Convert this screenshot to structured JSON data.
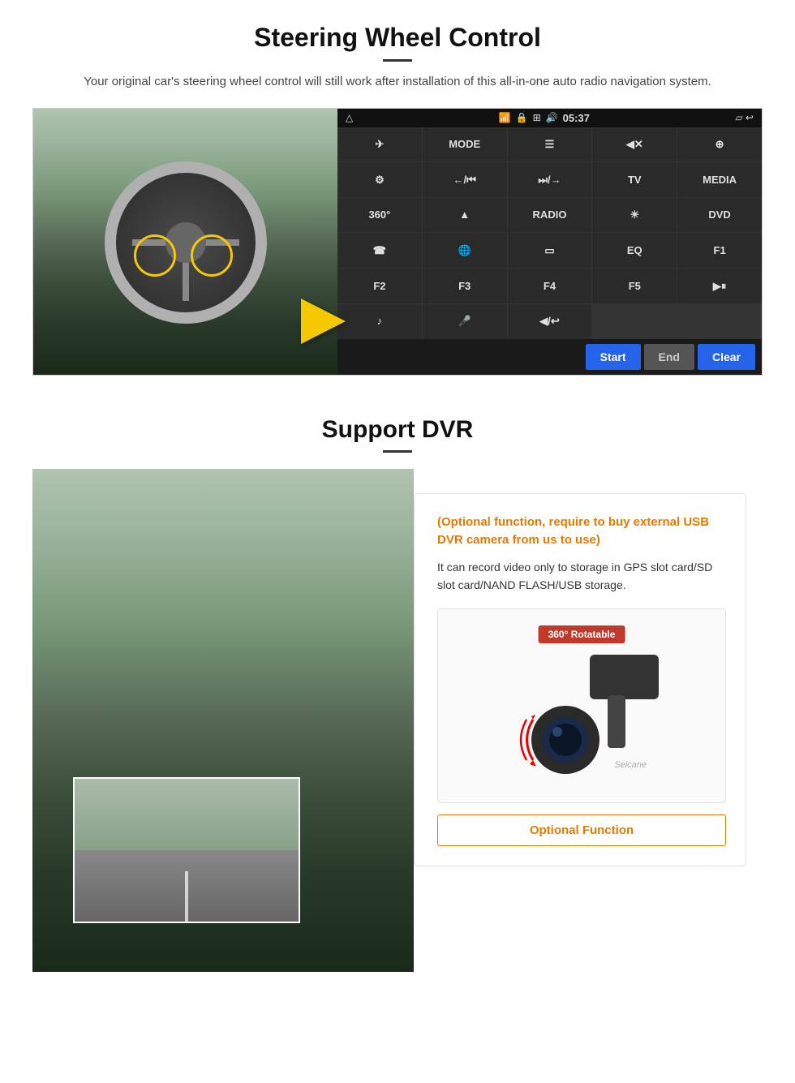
{
  "section1": {
    "title": "Steering Wheel Control",
    "subtitle": "Your original car's steering wheel control will still work after installation of this all-in-one auto radio navigation system.",
    "status_bar": {
      "time": "05:37",
      "icons": [
        "wifi",
        "lock",
        "grid",
        "volume"
      ]
    },
    "buttons": [
      {
        "label": "⊲",
        "row": 1
      },
      {
        "label": "MODE",
        "row": 1
      },
      {
        "label": "≡",
        "row": 1
      },
      {
        "label": "◀✕",
        "row": 1
      },
      {
        "label": "⊕",
        "row": 1
      },
      {
        "label": "⚙",
        "row": 2
      },
      {
        "label": "←/⏮",
        "row": 2
      },
      {
        "label": "⏭/→",
        "row": 2
      },
      {
        "label": "TV",
        "row": 2
      },
      {
        "label": "MEDIA",
        "row": 2
      },
      {
        "label": "360°",
        "row": 3
      },
      {
        "label": "▲",
        "row": 3
      },
      {
        "label": "RADIO",
        "row": 3
      },
      {
        "label": "☀",
        "row": 3
      },
      {
        "label": "DVD",
        "row": 3
      },
      {
        "label": "☎",
        "row": 4
      },
      {
        "label": "☁",
        "row": 4
      },
      {
        "label": "⊟",
        "row": 4
      },
      {
        "label": "EQ",
        "row": 4
      },
      {
        "label": "F1",
        "row": 4
      },
      {
        "label": "F2",
        "row": 5
      },
      {
        "label": "F3",
        "row": 5
      },
      {
        "label": "F4",
        "row": 5
      },
      {
        "label": "F5",
        "row": 5
      },
      {
        "label": "▶⏸",
        "row": 5
      },
      {
        "label": "♪",
        "row": 6
      },
      {
        "label": "🎤",
        "row": 6
      },
      {
        "label": "◀/↩",
        "row": 6
      }
    ],
    "controls": {
      "start": "Start",
      "end": "End",
      "clear": "Clear"
    }
  },
  "section2": {
    "title": "Support DVR",
    "optional_text": "(Optional function, require to buy external USB DVR camera from us to use)",
    "description": "It can record video only to storage in GPS slot card/SD slot card/NAND FLASH/USB storage.",
    "camera_badge": "360° Rotatable",
    "watermark": "Seicane",
    "optional_fn_label": "Optional Function"
  }
}
